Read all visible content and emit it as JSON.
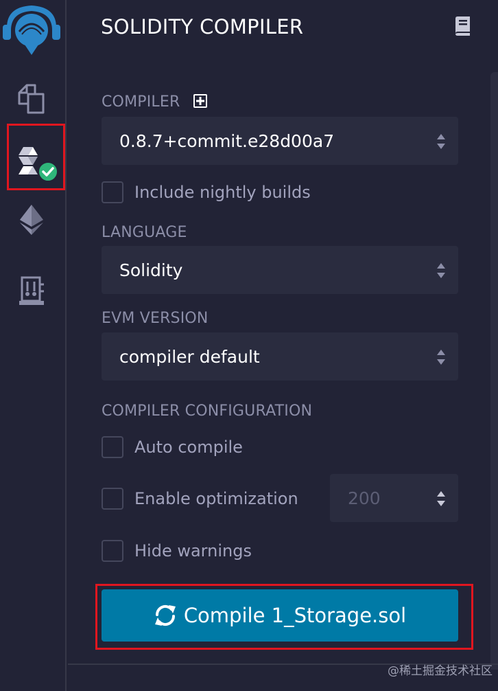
{
  "panel": {
    "title": "SOLIDITY COMPILER"
  },
  "compiler": {
    "label": "COMPILER",
    "selected_version": "0.8.7+commit.e28d00a7",
    "nightly_label": "Include nightly builds",
    "nightly_checked": false
  },
  "language": {
    "label": "LANGUAGE",
    "selected": "Solidity"
  },
  "evm": {
    "label": "EVM VERSION",
    "selected": "compiler default"
  },
  "config": {
    "label": "COMPILER CONFIGURATION",
    "auto_compile_label": "Auto compile",
    "auto_compile_checked": false,
    "optimization_label": "Enable optimization",
    "optimization_checked": false,
    "runs_value": "200",
    "hide_warnings_label": "Hide warnings",
    "hide_warnings_checked": false
  },
  "compile_button": {
    "label": "Compile 1_Storage.sol"
  },
  "sidebar": {
    "items": [
      {
        "icon": "file-explorer-icon"
      },
      {
        "icon": "solidity-compiler-icon",
        "active": true,
        "status": "success"
      },
      {
        "icon": "deploy-run-icon"
      },
      {
        "icon": "plugin-manager-icon"
      }
    ]
  },
  "colors": {
    "accent": "#007aa6",
    "success": "#2fb67a",
    "highlight": "#e0161f",
    "logo": "#2c87c9"
  },
  "watermark": "@稀土掘金技术社区"
}
